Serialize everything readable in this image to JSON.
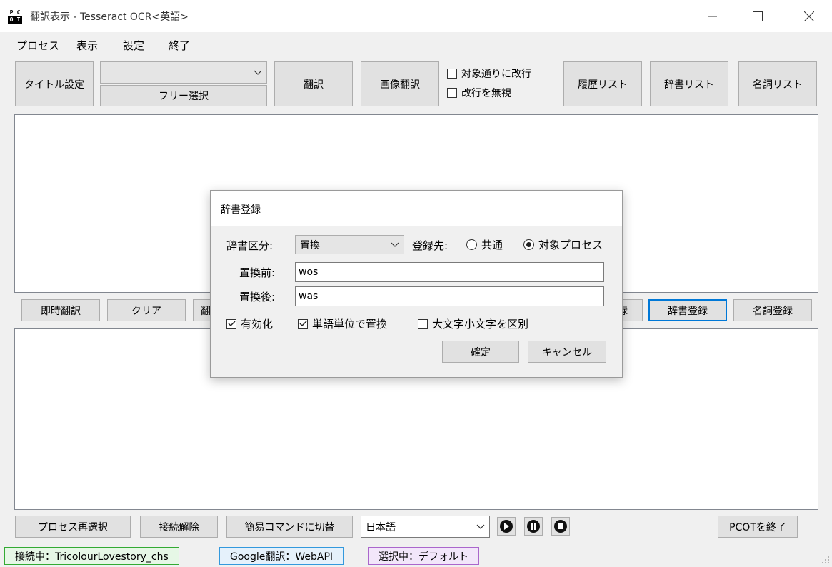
{
  "window": {
    "icon_letters": [
      "P",
      "C",
      "O",
      "T"
    ],
    "title": "翻訳表示 - Tesseract OCR<英語>",
    "controls": {
      "minimize": "—",
      "maximize": "☐",
      "close": "✕"
    }
  },
  "menu": {
    "items": [
      "プロセス",
      "表示",
      "設定",
      "終了"
    ]
  },
  "toolbar": {
    "title_setting": "タイトル設定",
    "combo_value": "",
    "free_select": "フリー選択",
    "translate": "翻訳",
    "image_translate": "画像翻訳",
    "checkbox_target_newline": "対象通りに改行",
    "checkbox_ignore_newline": "改行を無視",
    "history_list": "履歴リスト",
    "dictionary_list": "辞書リスト",
    "noun_list": "名詞リスト"
  },
  "action_row": {
    "instant_translate": "即時翻訳",
    "clear": "クリア",
    "translate_partial": "翻",
    "hidden_partial": "録",
    "dictionary_register": "辞書登録",
    "noun_register": "名詞登録"
  },
  "dialog": {
    "title": "辞書登録",
    "category_label": "辞書区分:",
    "category_value": "置換",
    "destination_label": "登録先:",
    "radio_common": "共通",
    "radio_target_process": "対象プロセス",
    "radio_selected": "対象プロセス",
    "before_label": "置換前:",
    "before_value": "wos",
    "after_label": "置換後:",
    "after_value": "was",
    "cb_enabled": "有効化",
    "cb_enabled_checked": true,
    "cb_word_unit": "単語単位で置換",
    "cb_word_unit_checked": true,
    "cb_case_sensitive": "大文字小文字を区別",
    "cb_case_sensitive_checked": false,
    "ok": "確定",
    "cancel": "キャンセル"
  },
  "bottom": {
    "reselect_process": "プロセス再選択",
    "disconnect": "接続解除",
    "switch_simple": "簡易コマンドに切替",
    "language_value": "日本語",
    "exit_pcot": "PCOTを終了"
  },
  "status": {
    "connection": "接続中：TricolourLovestory_chs",
    "engine": "Google翻訳：WebAPI",
    "selection": "選択中：デフォルト",
    "colors": {
      "connection_bg": "#e6f7e6",
      "connection_border": "#33aa33",
      "engine_bg": "#e5f1fb",
      "engine_border": "#3399dd",
      "selection_bg": "#f2e6fa",
      "selection_border": "#aa66cc"
    }
  }
}
